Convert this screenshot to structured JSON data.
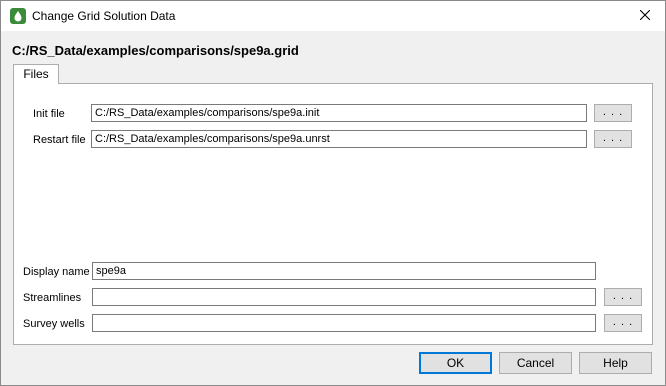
{
  "window": {
    "title": "Change Grid Solution Data",
    "path": "C:/RS_Data/examples/comparisons/spe9a.grid"
  },
  "tabs": [
    {
      "label": "Files"
    }
  ],
  "files": {
    "init_label": "Init file",
    "init_value": "C:/RS_Data/examples/comparisons/spe9a.init",
    "restart_label": "Restart file",
    "restart_value": "C:/RS_Data/examples/comparisons/spe9a.unrst",
    "browse_label": ". . ."
  },
  "display": {
    "name_label": "Display name",
    "name_value": "spe9a",
    "streamlines_label": "Streamlines",
    "streamlines_value": "",
    "survey_label": "Survey wells",
    "survey_value": ""
  },
  "buttons": {
    "ok": "OK",
    "cancel": "Cancel",
    "help": "Help"
  },
  "icons": {
    "app": "droplet-icon",
    "close": "close-icon"
  },
  "colors": {
    "accent": "#0078d7",
    "icon_green": "#3c8b3a"
  }
}
